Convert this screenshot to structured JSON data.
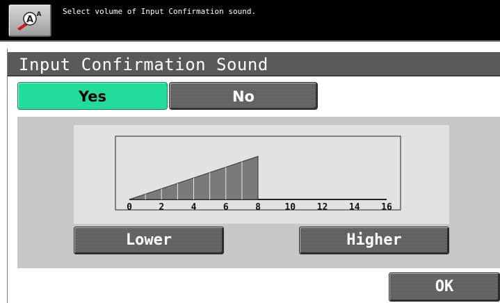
{
  "header": {
    "message": "Select volume of Input Confirmation sound.",
    "accessibility_icon": "accessibility-icon"
  },
  "screen": {
    "title": "Input Confirmation Sound"
  },
  "toggle": {
    "yes_label": "Yes",
    "no_label": "No",
    "selected": "Yes",
    "selected_color": "#22dd9a"
  },
  "volume": {
    "current_level": 8,
    "min": 0,
    "max": 16,
    "ticks": [
      "0",
      "2",
      "4",
      "6",
      "8",
      "10",
      "12",
      "14",
      "16"
    ],
    "lower_label": "Lower",
    "higher_label": "Higher"
  },
  "footer": {
    "ok_label": "OK"
  }
}
